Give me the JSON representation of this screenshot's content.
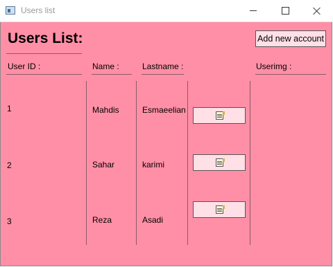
{
  "window": {
    "title": "Users list"
  },
  "header": {
    "title": "Users List:",
    "add_button_label": "Add new account"
  },
  "columns": {
    "id": "User ID :",
    "name": "Name :",
    "lastname": "Lastname :",
    "userimg": "Userimg :"
  },
  "rows": [
    {
      "id": "1",
      "name": "Mahdis",
      "lastname": "Esmaeelian"
    },
    {
      "id": "2",
      "name": "Sahar",
      "lastname": "karimi"
    },
    {
      "id": "3",
      "name": "Reza",
      "lastname": "Asadi"
    }
  ],
  "icons": {
    "app": "window-app-icon",
    "row_button": "document-icon"
  },
  "colors": {
    "background": "#ff8fa6",
    "button_face": "#ffe0e7"
  }
}
